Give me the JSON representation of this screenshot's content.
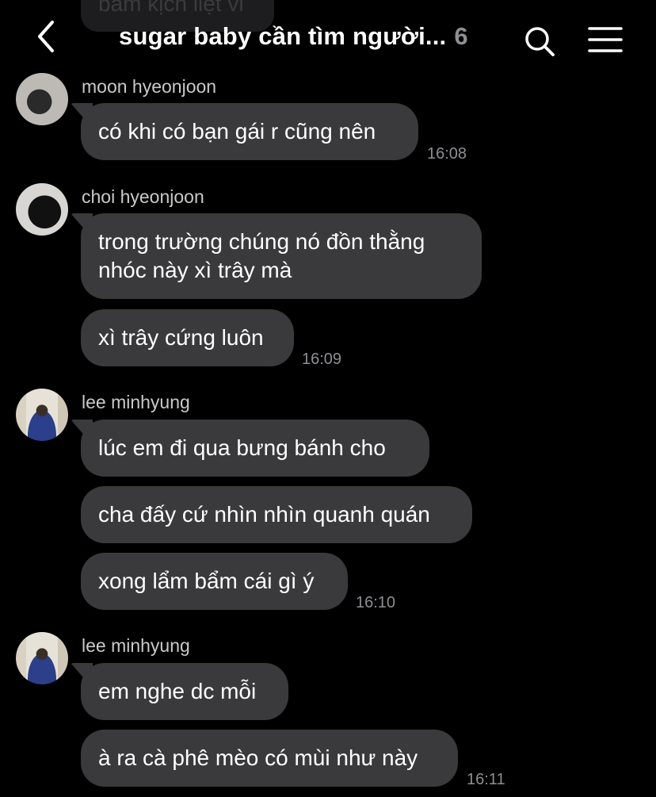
{
  "header": {
    "back_icon": "chevron-left-icon",
    "title": "sugar baby cần tìm người...",
    "member_count": "6",
    "search_icon": "search-icon",
    "menu_icon": "menu-icon",
    "peek_text": "bấm kịch liệt vl"
  },
  "groups": [
    {
      "sender": "moon hyeonjoon",
      "messages": [
        "có khi có bạn gái r cũng nên"
      ],
      "time": "16:08"
    },
    {
      "sender": "choi hyeonjoon",
      "messages": [
        "trong trường chúng nó đồn thằng",
        "nhóc này xì trây mà",
        "xì trây cứng luôn"
      ],
      "time": "16:09"
    },
    {
      "sender": "lee minhyung",
      "messages": [
        "lúc em đi qua bưng bánh cho",
        "cha đấy cứ nhìn nhìn quanh quán",
        "xong lẩm bẩm cái gì ý"
      ],
      "time": "16:10"
    },
    {
      "sender": "lee minhyung",
      "messages": [
        "em nghe dc mỗi",
        "à ra cà phê mèo có mùi như này"
      ],
      "time": "16:11"
    }
  ]
}
